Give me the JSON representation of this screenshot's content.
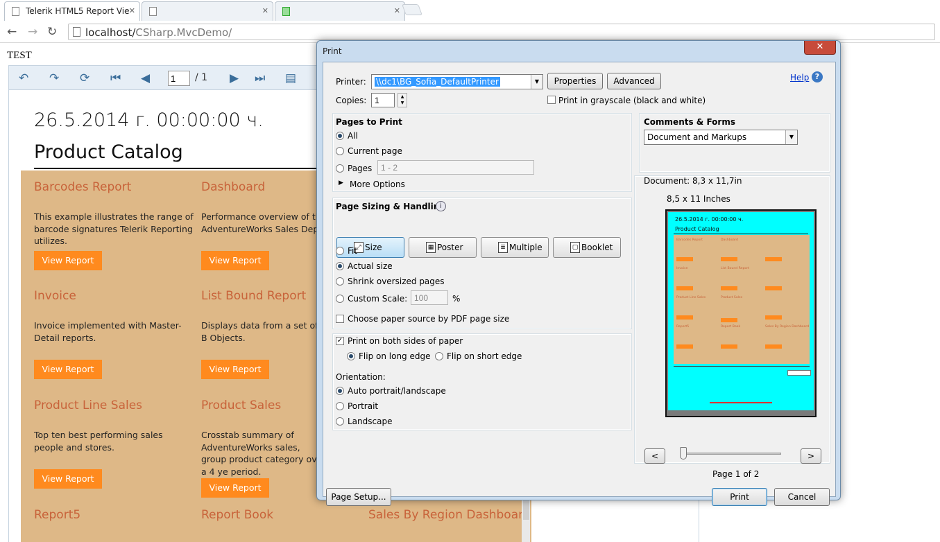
{
  "browser": {
    "tabs": [
      {
        "title": "Telerik HTML5 Report Vie",
        "state": "active"
      },
      {
        "title": "",
        "state": "blurred"
      },
      {
        "title": "",
        "state": "blurred"
      }
    ],
    "url_host": "localhost/",
    "url_path": "CSharp.MvcDemo/"
  },
  "page": {
    "test_label": "TEST",
    "viewer": {
      "page_current": "1",
      "page_total": "/ 1"
    },
    "report": {
      "date": "26.5.2014 г. 00:00:00 ч.",
      "title": "Product Catalog",
      "items": [
        {
          "title": "Barcodes Report",
          "desc": "This example illustrates the range of barcode signatures Telerik Reporting utilizes."
        },
        {
          "title": "Dashboard",
          "desc": "Performance overview of the AdventureWorks Sales Depar"
        },
        {
          "title": "Invoice",
          "desc": "Invoice implemented with Master-Detail reports."
        },
        {
          "title": "List Bound Report",
          "desc": "Displays data from a set of B Objects."
        },
        {
          "title": "Product Line Sales",
          "desc": "Top ten best performing sales people and stores."
        },
        {
          "title": "Product Sales",
          "desc": "Crosstab summary of AdventureWorks sales, group product category over a 4 ye period."
        },
        {
          "title": "Report5",
          "desc": ""
        },
        {
          "title": "Report Book",
          "desc": ""
        },
        {
          "title": "Sales By Region Dashboard",
          "desc": ""
        }
      ],
      "view_button": "View Report"
    }
  },
  "print_dialog": {
    "title": "Print",
    "printer_label": "Printer:",
    "printer_value": "\\\\dc1\\BG_Sofia_DefaultPrinter",
    "properties_button": "Properties",
    "advanced_button": "Advanced",
    "help_link": "Help",
    "copies_label": "Copies:",
    "copies_value": "1",
    "grayscale_label": "Print in grayscale (black and white)",
    "pages_to_print": {
      "heading": "Pages to Print",
      "all": "All",
      "current_page": "Current page",
      "pages": "Pages",
      "pages_value": "1 - 2",
      "more_options": "More Options"
    },
    "sizing": {
      "heading": "Page Sizing & Handling",
      "buttons": [
        "Size",
        "Poster",
        "Multiple",
        "Booklet"
      ],
      "fit": "Fit",
      "actual_size": "Actual size",
      "shrink": "Shrink oversized pages",
      "custom_scale": "Custom Scale:",
      "scale_value": "100",
      "scale_unit": "%",
      "paper_source": "Choose paper source by PDF page size"
    },
    "duplex": {
      "both_sides": "Print on both sides of paper",
      "long_edge": "Flip on long edge",
      "short_edge": "Flip on short edge"
    },
    "orientation": {
      "label": "Orientation:",
      "auto": "Auto portrait/landscape",
      "portrait": "Portrait",
      "landscape": "Landscape"
    },
    "comments_forms": {
      "heading": "Comments & Forms",
      "value": "Document and Markups"
    },
    "preview": {
      "document_size": "Document: 8,3 x 11,7in",
      "paper_size": "8,5 x 11 Inches",
      "page_date": "26.5.2014 г. 00:00:00 ч.",
      "page_title": "Product Catalog",
      "prev": "<",
      "next": ">",
      "page_indicator": "Page 1 of 2"
    },
    "page_setup_button": "Page Setup...",
    "print_button": "Print",
    "cancel_button": "Cancel"
  }
}
